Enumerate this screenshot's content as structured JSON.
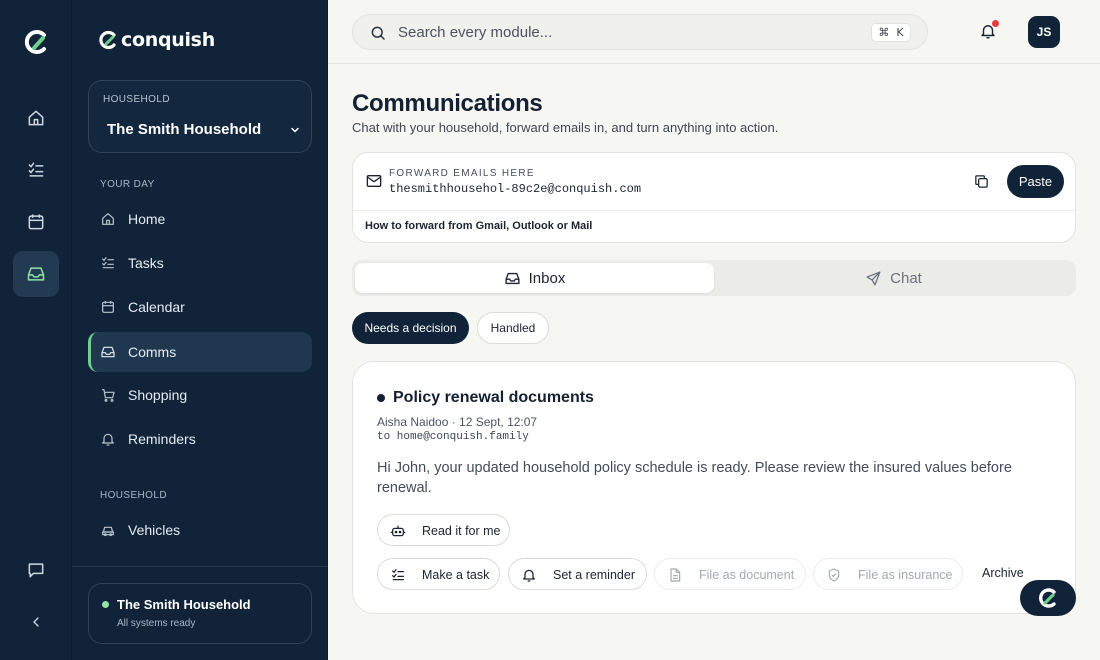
{
  "app": {
    "brand_name": "conquish",
    "accent_color": "#102338",
    "success_color": "#8fe3a5"
  },
  "rail": {
    "items": [
      {
        "icon": "home-icon"
      },
      {
        "icon": "tasks-icon"
      },
      {
        "icon": "calendar-icon"
      },
      {
        "icon": "inbox-icon",
        "active": true
      }
    ],
    "bottom": [
      {
        "icon": "chat-bubble-icon"
      },
      {
        "icon": "collapse-chevron-icon"
      }
    ]
  },
  "sidebar": {
    "household_select": {
      "label": "HOUSEHOLD",
      "value": "The Smith Household"
    },
    "sections": [
      {
        "heading": "YOUR DAY",
        "items": [
          {
            "label": "Home",
            "icon": "home-icon"
          },
          {
            "label": "Tasks",
            "icon": "tasks-icon"
          },
          {
            "label": "Calendar",
            "icon": "calendar-icon"
          },
          {
            "label": "Comms",
            "icon": "inbox-icon",
            "active": true
          },
          {
            "label": "Shopping",
            "icon": "cart-icon"
          },
          {
            "label": "Reminders",
            "icon": "bell-icon"
          }
        ]
      },
      {
        "heading": "HOUSEHOLD",
        "items": [
          {
            "label": "Vehicles",
            "icon": "car-icon"
          }
        ]
      }
    ],
    "status": {
      "title": "The Smith Household",
      "subtitle": "All systems ready"
    }
  },
  "topbar": {
    "search_placeholder": "Search every module...",
    "shortcut_symbol": "⌘",
    "shortcut_key": "K",
    "avatar_initials": "JS"
  },
  "page": {
    "title": "Communications",
    "subtitle": "Chat with your household, forward emails in, and turn anything into action."
  },
  "forward": {
    "label": "FORWARD EMAILS HERE",
    "address": "thesmithhousehol-89c2e@conquish.com",
    "paste_label": "Paste",
    "howto_label": "How to forward from Gmail, Outlook or Mail"
  },
  "tabs": [
    {
      "label": "Inbox",
      "icon": "inbox-icon",
      "active": true
    },
    {
      "label": "Chat",
      "icon": "send-icon",
      "active": false
    }
  ],
  "filters": [
    {
      "label": "Needs a decision",
      "active": true
    },
    {
      "label": "Handled",
      "active": false
    }
  ],
  "message": {
    "subject": "Policy renewal documents",
    "meta": "Aisha Naidoo · 12 Sept, 12:07",
    "to": "to home@conquish.family",
    "body": "Hi John, your updated household policy schedule is ready. Please review the insured values before renewal.",
    "actions": {
      "read": "Read it for me",
      "task": "Make a task",
      "reminder": "Set a reminder",
      "document": "File as document",
      "insurance": "File as insurance",
      "archive": "Archive"
    }
  }
}
